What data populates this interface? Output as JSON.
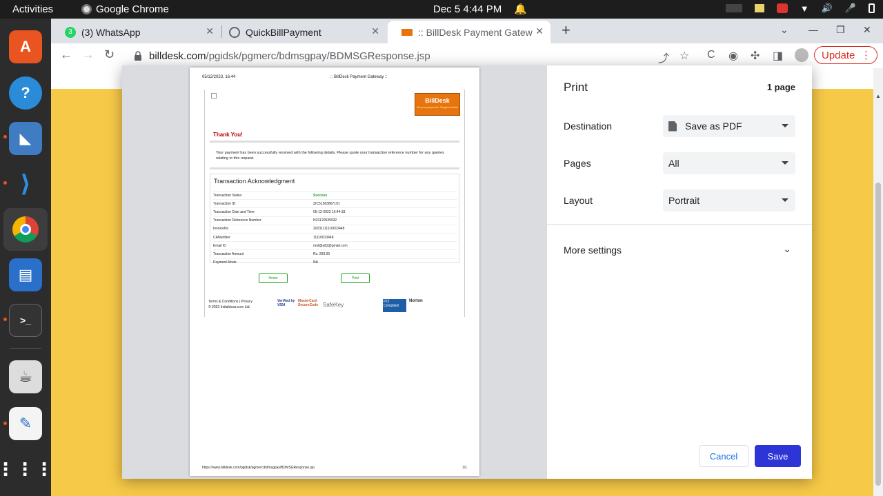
{
  "topbar": {
    "activities": "Activities",
    "app_name": "Google Chrome",
    "clock": "Dec 5  4:44 PM"
  },
  "tabs": [
    {
      "label": "(3) WhatsApp",
      "favicon_badge": "3"
    },
    {
      "label": "QuickBillPayment"
    },
    {
      "label": ":: BillDesk Payment Gatew"
    }
  ],
  "address": {
    "host": "billdesk.com",
    "path": "/pgidsk/pgmerc/bdmsgpay/BDMSGResponse.jsp"
  },
  "update_label": "Update",
  "print": {
    "title": "Print",
    "page_count": "1 page",
    "destination_label": "Destination",
    "destination_value": "Save as PDF",
    "pages_label": "Pages",
    "pages_value": "All",
    "layout_label": "Layout",
    "layout_value": "Portrait",
    "more_settings": "More settings",
    "cancel": "Cancel",
    "save": "Save"
  },
  "sheet": {
    "header_left": "05/12/2023, 16:44",
    "header_center": ":: BillDesk Payment Gateway ::",
    "logo_text": "BillDesk",
    "logo_tagline": "All your payments. Single location",
    "thank_you": "Thank You!",
    "message": "Your payment has been successfully received with the following details. Please quote your transaction reference number for any queries relating to this request.",
    "section_title": "Transaction Acknowledgment",
    "rows": [
      {
        "k": "Transaction Status",
        "v": "Success"
      },
      {
        "k": "Transaction ID",
        "v": "ZIC51583867191"
      },
      {
        "k": "Transaction Date and Time",
        "v": "05-12-2023 16:44:33"
      },
      {
        "k": "Transaction Reference Number",
        "v": "N23120535932"
      },
      {
        "k": "InvoiceNo",
        "v": "20231111110013448"
      },
      {
        "k": "CANumber",
        "v": "11110013448"
      },
      {
        "k": "Email ID",
        "v": "muf@a82@gmail.com"
      },
      {
        "k": "Transaction Amount",
        "v": "Rs. 293.00"
      },
      {
        "k": "Payment Mode",
        "v": "NA"
      }
    ],
    "home_btn": "Home",
    "print_btn": "Print",
    "footer_line1": "Terms & Conditions | Privacy",
    "footer_line2": "© 2023 Indialdeas.com Ltd.",
    "badge_visa": "Verified by VISA",
    "badge_mc": "MasterCard SecureCode",
    "badge_safekey": "SafeKey",
    "badge_pci": "PCI Compliant",
    "badge_norton": "Norton",
    "footer_url": "https://www.billdesk.com/pgidsk/pgmerc/bdmsgpay/BDMSGResponse.jsp",
    "page_no": "1/1"
  },
  "colors": {
    "accent": "#2e35d6",
    "success": "#1aa31a",
    "update": "#d93025",
    "page_bg": "#f7c948"
  }
}
